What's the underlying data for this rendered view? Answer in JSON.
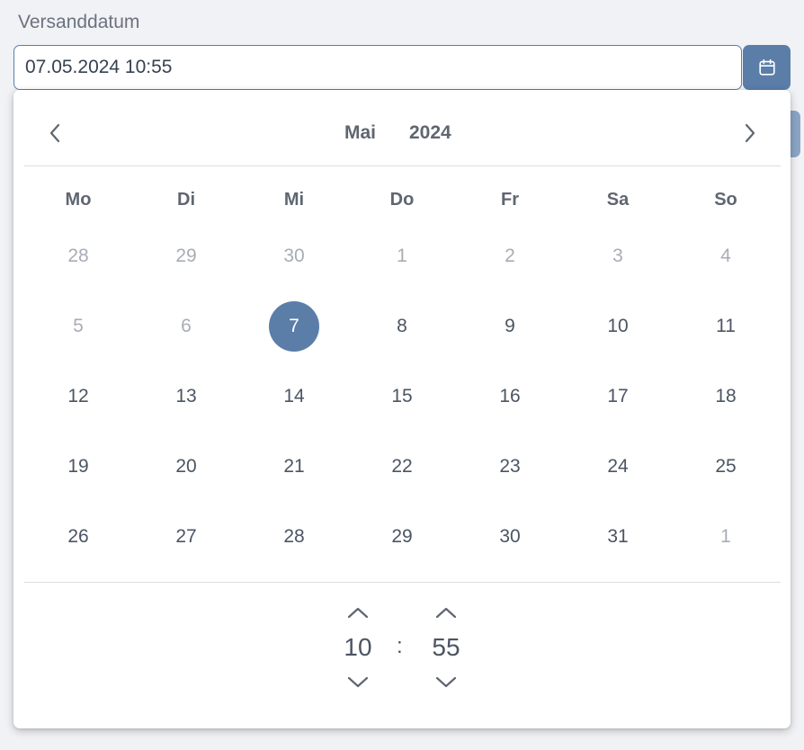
{
  "field": {
    "label": "Versanddatum",
    "value": "07.05.2024 10:55"
  },
  "calendar_button": {
    "icon": "calendar-icon"
  },
  "picker": {
    "month": "Mai",
    "year": "2024",
    "weekdays": [
      "Mo",
      "Di",
      "Mi",
      "Do",
      "Fr",
      "Sa",
      "So"
    ],
    "days": [
      {
        "label": "28",
        "muted": true
      },
      {
        "label": "29",
        "muted": true
      },
      {
        "label": "30",
        "muted": true
      },
      {
        "label": "1",
        "muted": true
      },
      {
        "label": "2",
        "muted": true
      },
      {
        "label": "3",
        "muted": true
      },
      {
        "label": "4",
        "muted": true
      },
      {
        "label": "5",
        "muted": true
      },
      {
        "label": "6",
        "muted": true
      },
      {
        "label": "7",
        "selected": true
      },
      {
        "label": "8"
      },
      {
        "label": "9"
      },
      {
        "label": "10"
      },
      {
        "label": "11"
      },
      {
        "label": "12"
      },
      {
        "label": "13"
      },
      {
        "label": "14"
      },
      {
        "label": "15"
      },
      {
        "label": "16"
      },
      {
        "label": "17"
      },
      {
        "label": "18"
      },
      {
        "label": "19"
      },
      {
        "label": "20"
      },
      {
        "label": "21"
      },
      {
        "label": "22"
      },
      {
        "label": "23"
      },
      {
        "label": "24"
      },
      {
        "label": "25"
      },
      {
        "label": "26"
      },
      {
        "label": "27"
      },
      {
        "label": "28"
      },
      {
        "label": "29"
      },
      {
        "label": "30"
      },
      {
        "label": "31"
      },
      {
        "label": "1",
        "muted": true
      }
    ],
    "time": {
      "hour": "10",
      "minute": "55",
      "separator": ":"
    }
  },
  "colors": {
    "accent": "#5b7ea9",
    "text": "#4b5563",
    "muted": "#a8adb5"
  }
}
